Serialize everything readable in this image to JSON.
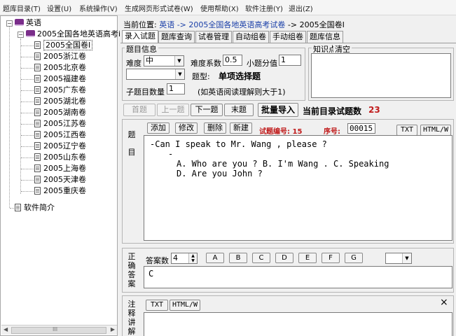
{
  "menu": [
    "题库目录(T)",
    "设置(U)",
    "系统操作(V)",
    "生成网页形式试卷(W)",
    "使用帮助(X)",
    "软件注册(Y)",
    "退出(Z)"
  ],
  "tree": {
    "root": "英语",
    "branch": "2005全国各地英语高考i",
    "selected": "2005全国卷Ⅰ",
    "items": [
      "2005浙江卷",
      "2005北京卷",
      "2005福建卷",
      "2005广东卷",
      "2005湖北卷",
      "2005湖南卷",
      "2005江苏卷",
      "2005江西卷",
      "2005辽宁卷",
      "2005山东卷",
      "2005上海卷",
      "2005天津卷",
      "2005重庆卷"
    ],
    "bottom": "软件简介",
    "hscroll_left": "◀",
    "hscroll_right": "▶",
    "hscroll_grip": "III"
  },
  "breadcrumb": {
    "prefix": "当前位置:",
    "path1": "英语 ->",
    "path2": "2005全国各地英语高考试卷",
    "path3": "-> 2005全国卷Ⅰ"
  },
  "tabs": [
    "录入试题",
    "题库查询",
    "试卷管理",
    "自动组卷",
    "手动组卷",
    "题库信息"
  ],
  "info": {
    "legend": "题目信息",
    "difficulty_label": "难度",
    "difficulty_value": "中",
    "coef_label": "难度系数",
    "coef_value": "0.5",
    "score_label": "小题分值",
    "score_value": "1",
    "type_label": "题型:",
    "type_value": "单项选择题",
    "subcount_label": "子题目数量",
    "subcount_value": "1",
    "subcount_note": "(如英语阅读理解则大于1)"
  },
  "knowledge": {
    "legend": "知识点",
    "clear": "清空"
  },
  "nav": {
    "first": "首题",
    "prev": "上一题",
    "next": "下一题",
    "last": "末题",
    "batch": "批量导入",
    "count_label": "当前目录试题数",
    "count_value": "23"
  },
  "question": {
    "side_label": [
      "题",
      "目"
    ],
    "add": "添加",
    "edit": "修改",
    "delete": "删除",
    "new": "新建",
    "id_label": "试题编号: 15",
    "seq_label": "序号:",
    "seq_value": "00015",
    "fmt_txt": "TXT",
    "fmt_html": "HTML/W",
    "line1": "-Can I speak to Mr. Wang , please ?",
    "line2": "-",
    "line3": "A. Who are you ?  B. I'm Wang .    C. Speaking",
    "line4": "D. Are you John ?"
  },
  "answer": {
    "side_label": [
      "正",
      "确",
      "答",
      "案"
    ],
    "count_label": "答案数",
    "count_value": "4",
    "options": [
      "A",
      "B",
      "C",
      "D",
      "E",
      "F",
      "G"
    ],
    "value": "C"
  },
  "explain": {
    "side_label": [
      "注",
      "释",
      "讲",
      "解"
    ],
    "fmt_txt": "TXT",
    "fmt_html": "HTML/W",
    "close": "×"
  }
}
